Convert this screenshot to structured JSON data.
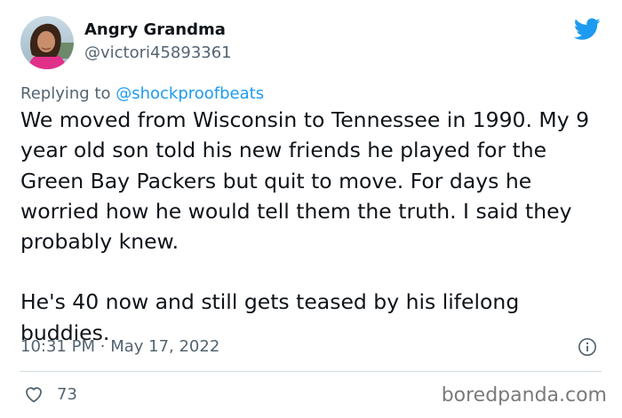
{
  "author": {
    "display_name": "Angry Grandma",
    "handle": "@victori45893361",
    "avatar": "avatar-photo"
  },
  "reply": {
    "prefix": "Replying to",
    "to_handle": "@shockproofbeats"
  },
  "tweet": {
    "paragraphs": [
      "We moved from Wisconsin to Tennessee in 1990. My 9 year old son told his new friends he played for the Green Bay Packers but quit to move. For days he worried how he would tell them the truth. I said they probably knew.",
      "He's 40 now and still gets teased by his lifelong buddies."
    ],
    "time": "10:31 PM",
    "separator": "·",
    "date": "May 17, 2022"
  },
  "stats": {
    "likes": "73"
  },
  "icons": {
    "brand": "twitter-bird-icon",
    "info": "info-icon",
    "like": "heart-icon"
  },
  "watermark": "boredpanda.com",
  "colors": {
    "accent": "#1d9bf0",
    "text": "#0f1419",
    "secondary": "#536471",
    "divider": "#cfd9de",
    "watermark": "#7a7a7a"
  }
}
